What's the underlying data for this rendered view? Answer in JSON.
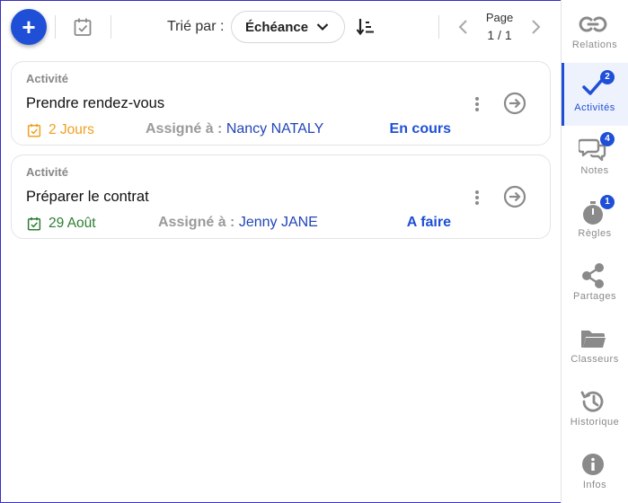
{
  "toolbar": {
    "add_label": "+",
    "sort_label": "Trié par :",
    "sort_value": "Échéance",
    "page_label": "Page",
    "page_value": "1 / 1"
  },
  "cards": [
    {
      "type": "Activité",
      "title": "Prendre rendez-vous",
      "due": "2 Jours",
      "due_color": "#f0a020",
      "assign_label": "Assigné à :",
      "assignee": "Nancy NATALY",
      "status": "En cours"
    },
    {
      "type": "Activité",
      "title": "Préparer le contrat",
      "due": "29 Août",
      "due_color": "#2e7d32",
      "assign_label": "Assigné à :",
      "assignee": "Jenny JANE",
      "status": "A faire"
    }
  ],
  "sidebar": {
    "items": [
      {
        "label": "Relations",
        "icon": "link-icon",
        "badge": null,
        "active": false
      },
      {
        "label": "Activités",
        "icon": "check-icon",
        "badge": "2",
        "active": true
      },
      {
        "label": "Notes",
        "icon": "chat-icon",
        "badge": "4",
        "active": false
      },
      {
        "label": "Règles",
        "icon": "stopwatch-icon",
        "badge": "1",
        "active": false
      },
      {
        "label": "Partages",
        "icon": "share-icon",
        "badge": null,
        "active": false
      },
      {
        "label": "Classeurs",
        "icon": "folder-icon",
        "badge": null,
        "active": false
      },
      {
        "label": "Historique",
        "icon": "history-icon",
        "badge": null,
        "active": false
      },
      {
        "label": "Infos",
        "icon": "info-icon",
        "badge": null,
        "active": false
      }
    ]
  },
  "colors": {
    "accent": "#1f4fd6",
    "assignee": "#2245b8",
    "muted": "#9a9a9a"
  }
}
